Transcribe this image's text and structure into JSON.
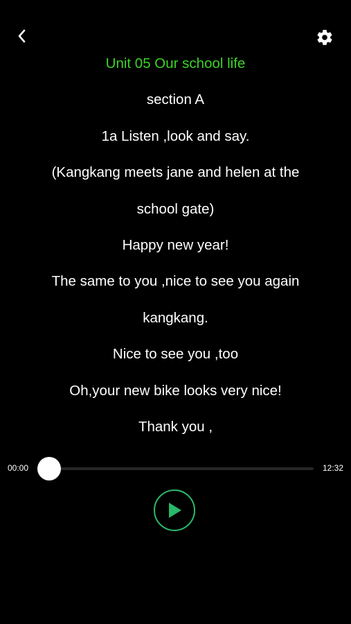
{
  "header": {
    "back_icon": "chevron-left-icon",
    "settings_icon": "gear-icon"
  },
  "lyrics": {
    "lines": [
      "Unit 05 Our school  life",
      "section A",
      "1a Listen ,look and say.",
      "(Kangkang meets jane and helen at the",
      "school gate)",
      "Happy new year!",
      "The same to you ,nice to see you again",
      "kangkang.",
      "Nice to see you ,too",
      "Oh,your new bike looks very nice!",
      "Thank you ,"
    ],
    "title_color": "#3ed12a"
  },
  "player": {
    "current_time": "00:00",
    "total_time": "12:32",
    "progress": 0,
    "play_icon": "play-icon",
    "accent_color": "#2ab86a"
  }
}
